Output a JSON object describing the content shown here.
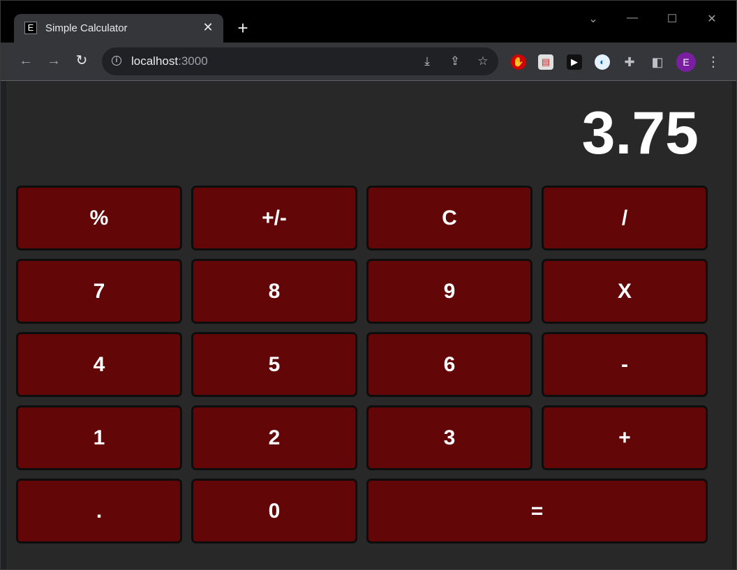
{
  "browser": {
    "tab": {
      "favicon_letter": "E",
      "title": "Simple Calculator",
      "close": "✕"
    },
    "new_tab": "+",
    "url": {
      "host": "localhost",
      "port": ":3000"
    },
    "profile_initial": "E"
  },
  "calculator": {
    "display": "3.75",
    "keys": [
      [
        "%",
        "+/-",
        "C",
        "/"
      ],
      [
        "7",
        "8",
        "9",
        "X"
      ],
      [
        "4",
        "5",
        "6",
        "-"
      ],
      [
        "1",
        "2",
        "3",
        "+"
      ],
      [
        ".",
        "0",
        "="
      ]
    ]
  },
  "colors": {
    "key_background": "#620607",
    "page_background": "#282828",
    "display_text": "#ffffff"
  }
}
